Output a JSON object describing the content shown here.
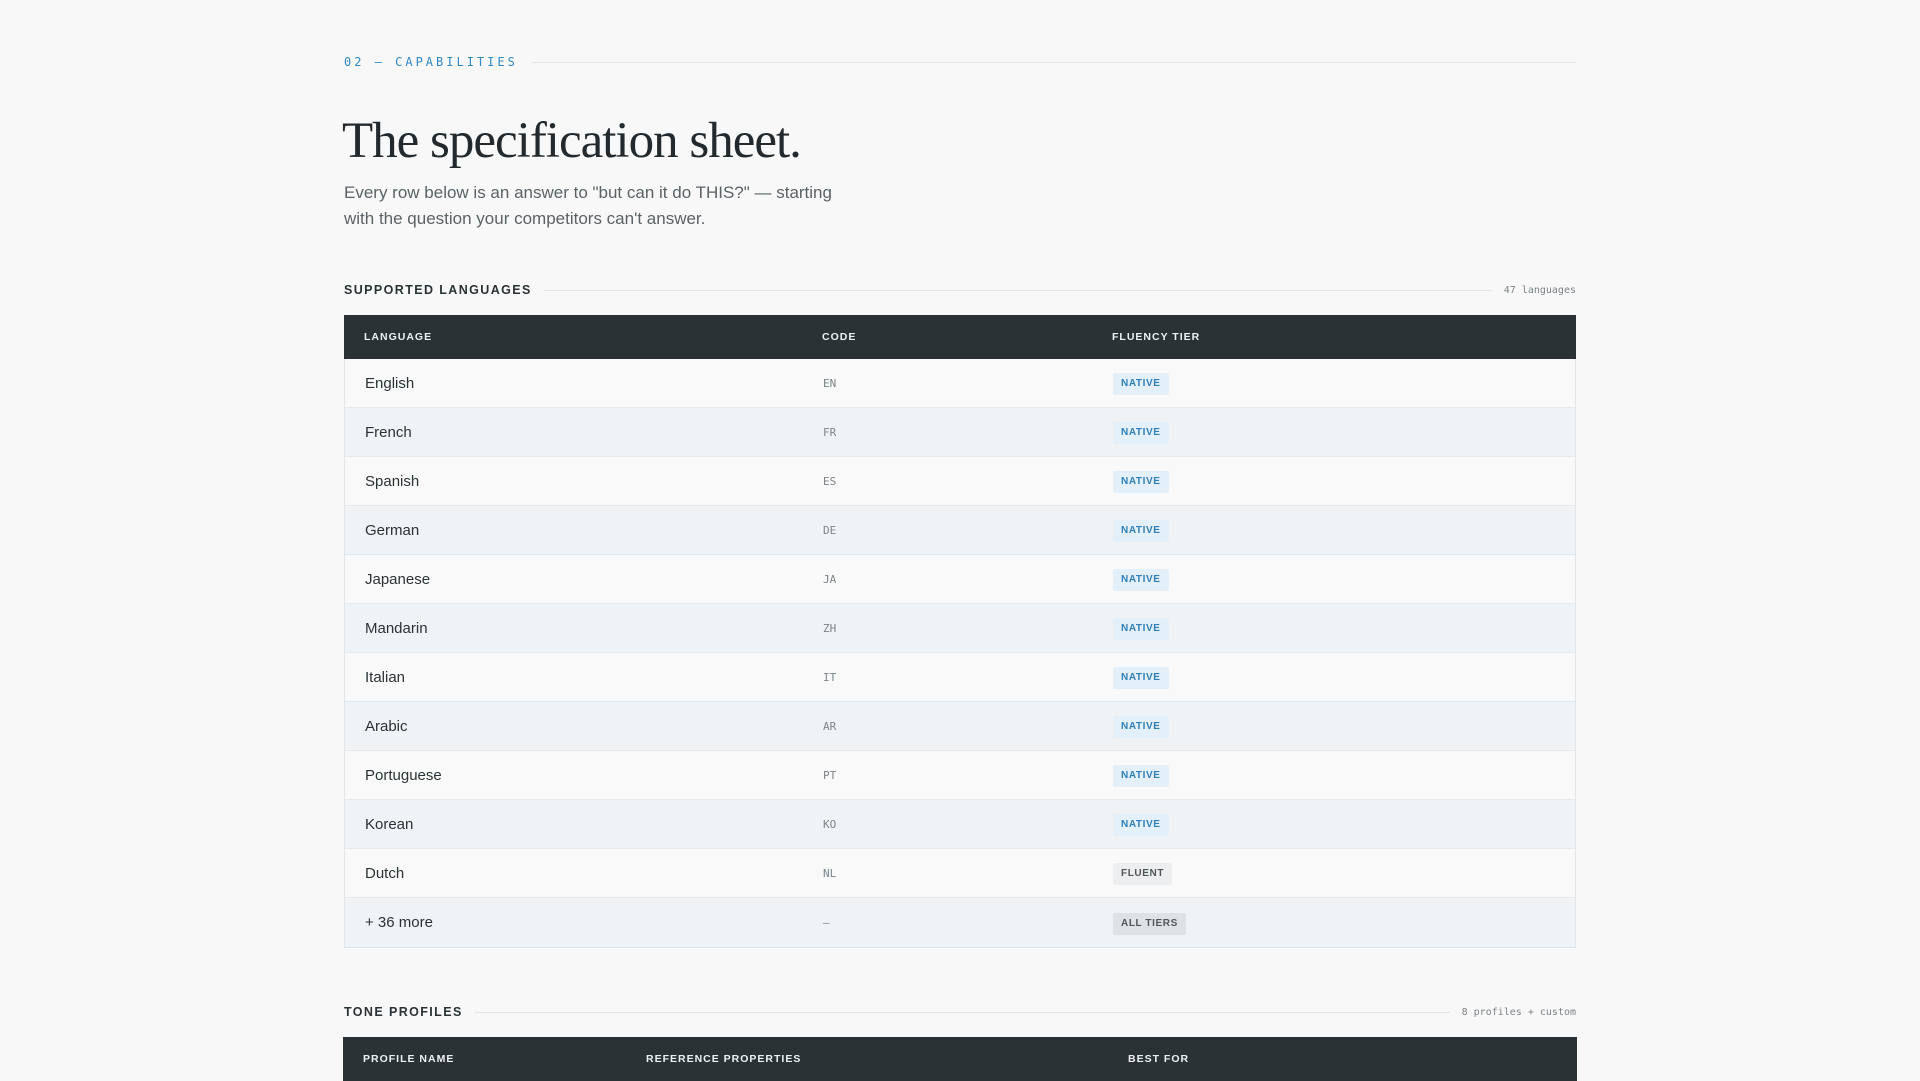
{
  "section": {
    "eyebrow": "02 — CAPABILITIES"
  },
  "title": "The specification sheet.",
  "lede": "Every row below is an answer to \"but can it do THIS?\" — starting with the question your competitors can't answer.",
  "languages": {
    "label": "SUPPORTED LANGUAGES",
    "meta": "47 languages",
    "headers": [
      "LANGUAGE",
      "CODE",
      "FLUENCY TIER"
    ],
    "rows": [
      {
        "name": "English",
        "code": "EN",
        "tier": "NATIVE"
      },
      {
        "name": "French",
        "code": "FR",
        "tier": "NATIVE"
      },
      {
        "name": "Spanish",
        "code": "ES",
        "tier": "NATIVE"
      },
      {
        "name": "German",
        "code": "DE",
        "tier": "NATIVE"
      },
      {
        "name": "Japanese",
        "code": "JA",
        "tier": "NATIVE"
      },
      {
        "name": "Mandarin",
        "code": "ZH",
        "tier": "NATIVE"
      },
      {
        "name": "Italian",
        "code": "IT",
        "tier": "NATIVE"
      },
      {
        "name": "Arabic",
        "code": "AR",
        "tier": "NATIVE"
      },
      {
        "name": "Portuguese",
        "code": "PT",
        "tier": "NATIVE"
      },
      {
        "name": "Korean",
        "code": "KO",
        "tier": "NATIVE"
      },
      {
        "name": "Dutch",
        "code": "NL",
        "tier": "FLUENT"
      },
      {
        "name": "+ 36 more",
        "code": "—",
        "tier": "ALL TIERS"
      }
    ]
  },
  "tones": {
    "label": "TONE PROFILES",
    "meta": "8 profiles + custom",
    "headers": [
      "PROFILE NAME",
      "REFERENCE PROPERTIES",
      "BEST FOR"
    ]
  },
  "colors": {
    "accent": "#2f89c4",
    "header_bg": "#2b3235",
    "page_bg": "#f8f8f8",
    "native_badge_bg": "#e4f0f9",
    "native_badge_text": "#2f7fb8"
  }
}
